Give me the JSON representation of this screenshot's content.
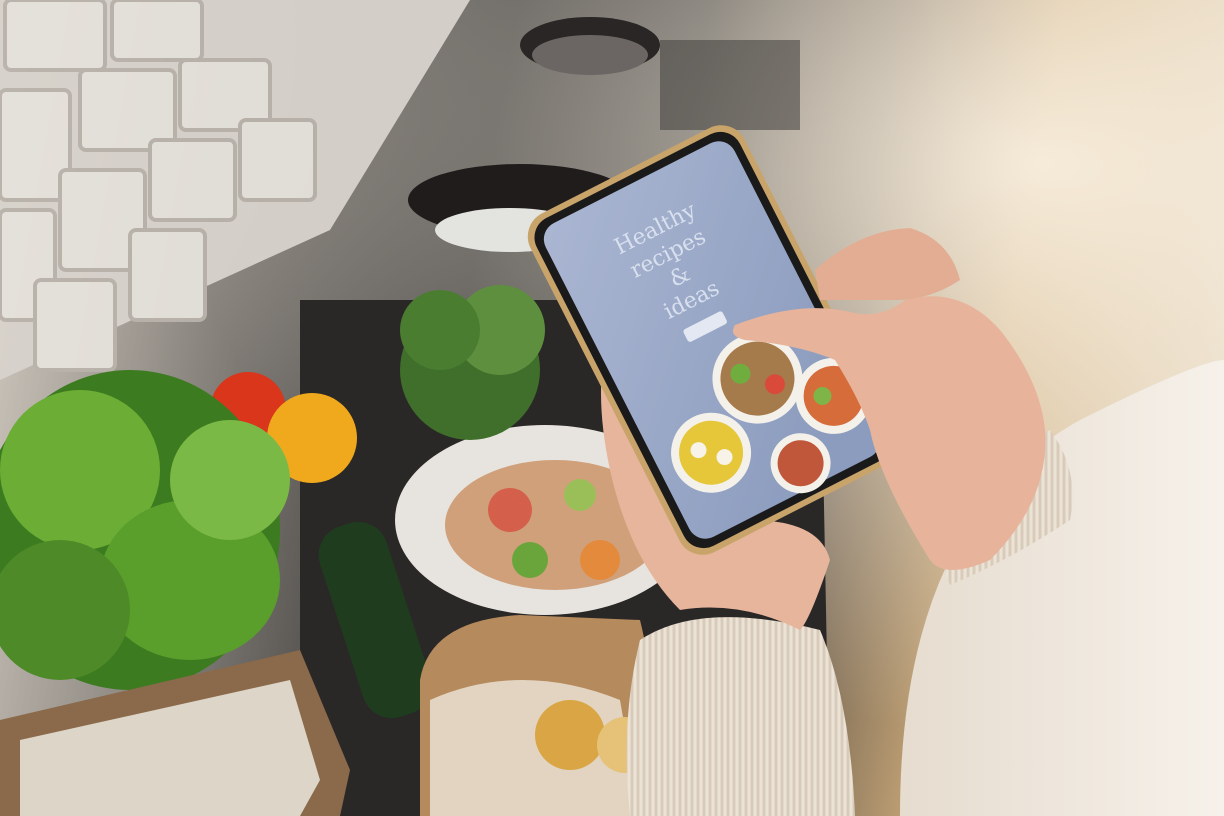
{
  "scene": {
    "description_free": true,
    "colors": {
      "tile": "#e9e6e1",
      "counter": "#2b2928",
      "warm_light": "#e8d6b6",
      "sweater": "#efe8df",
      "skin": "#e8b9a1",
      "phone_frame": "#c9a46a",
      "screen": "#9aa9c8",
      "greens": "#5fa12e"
    }
  },
  "phone": {
    "screen_title_lines": [
      "Healthy",
      "recipes",
      "&",
      "ideas"
    ],
    "button_icon": "cta-button"
  }
}
